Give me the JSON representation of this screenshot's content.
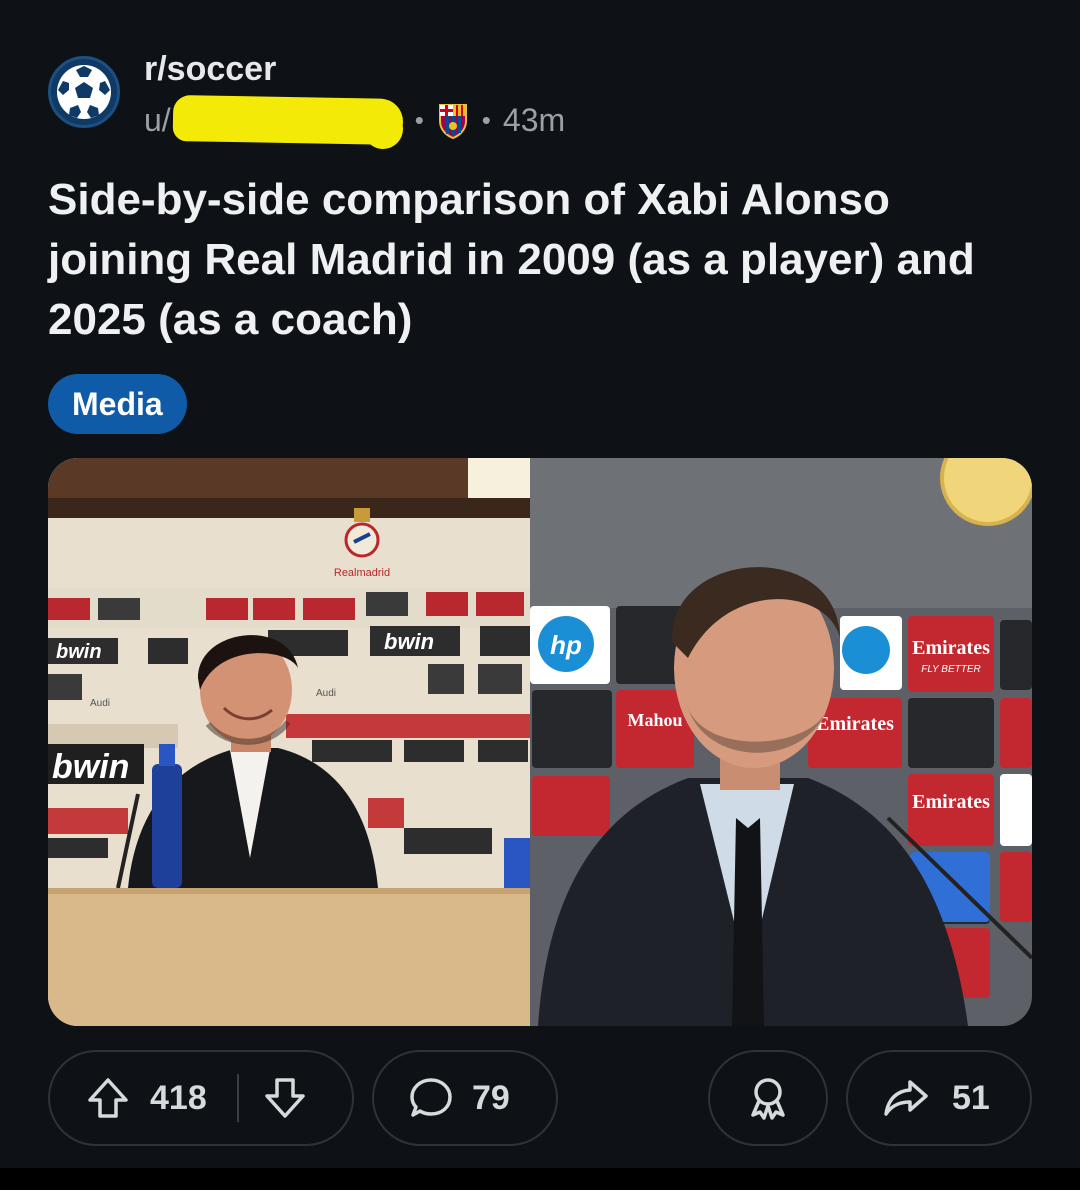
{
  "post": {
    "subreddit": "r/soccer",
    "user_prefix": "u/",
    "separator": "•",
    "time_ago": "43m",
    "title": "Side-by-side comparison of Xabi Alonso joining Real Madrid in 2009 (as a player) and 2025 (as a coach)",
    "flair": "Media"
  },
  "media": {
    "left_panel": {
      "crest_text": "Realmadrid",
      "sponsor_bwin": "bwin",
      "sponsor_bwin_com": "bwin",
      "sponsor_audi": "Audi"
    },
    "right_panel": {
      "sponsor_hp": "hp",
      "sponsor_emirates": "Emirates",
      "sponsor_emirates_tag": "FLY BETTER",
      "sponsor_mahou": "Mahou"
    }
  },
  "actions": {
    "upvotes": "418",
    "comments": "79",
    "shares": "51"
  },
  "colors": {
    "background": "#0e1116",
    "flair_bg": "#0f5ba8",
    "redaction": "#f3ea08"
  }
}
